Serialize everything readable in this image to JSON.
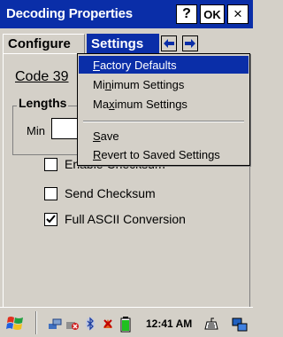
{
  "window": {
    "title": "Decoding Properties",
    "help_label": "?",
    "ok_label": "OK",
    "close_label": "×"
  },
  "tabs": [
    {
      "label": "Configure",
      "active": false
    },
    {
      "label": "Settings",
      "active": true
    }
  ],
  "content": {
    "code_label": "Code 39",
    "lengths_group": "Lengths",
    "min_label": "Min",
    "min_value": ""
  },
  "checkboxes": [
    {
      "label": "Enable Checksum",
      "checked": false
    },
    {
      "label": "Send Checksum",
      "checked": false
    },
    {
      "label": "Full ASCII Conversion",
      "checked": true
    }
  ],
  "menu": {
    "items": [
      {
        "label": "Factory Defaults",
        "accelerator": "F",
        "selected": true
      },
      {
        "label": "Minimum Settings",
        "accelerator": "n",
        "selected": false
      },
      {
        "label": "Maximum Settings",
        "accelerator": "x",
        "selected": false
      },
      {
        "label": "Save",
        "accelerator": "S",
        "selected": false
      },
      {
        "label": "Revert to Saved Settings",
        "accelerator": "R",
        "selected": false
      }
    ]
  },
  "taskbar": {
    "clock": "12:41 AM"
  },
  "colors": {
    "accent": "#0a2ea8",
    "face": "#d4d0c8"
  }
}
